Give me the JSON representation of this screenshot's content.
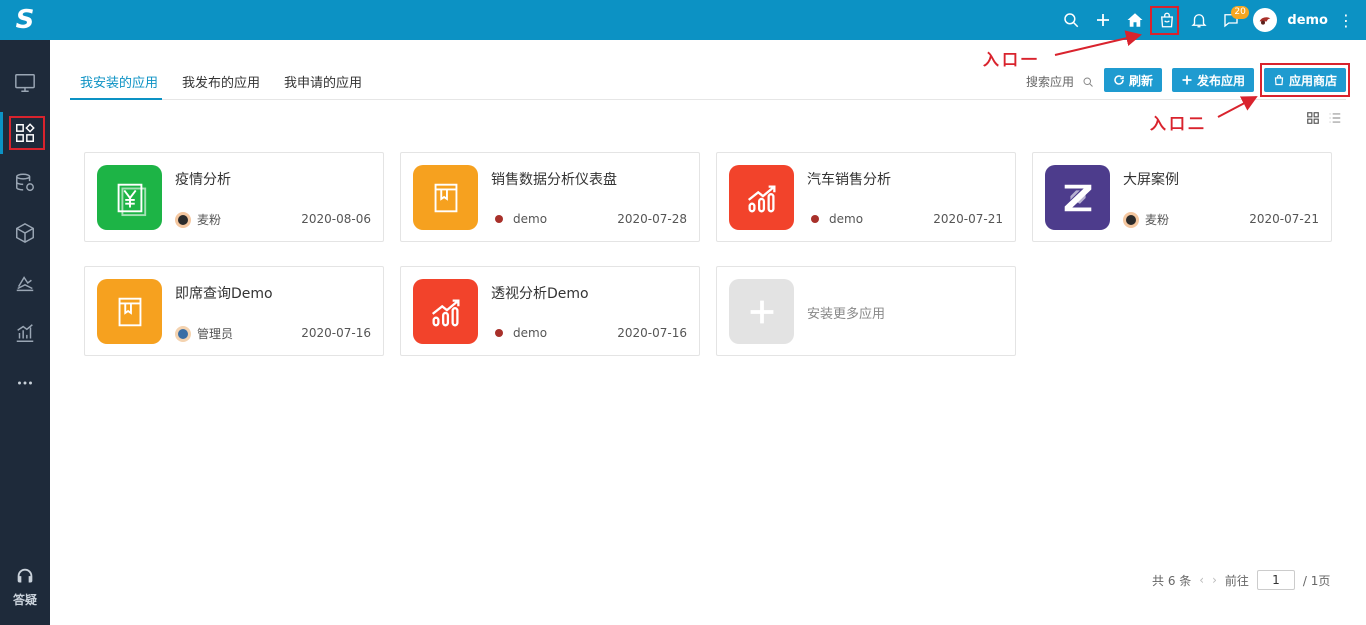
{
  "logo": "S",
  "sidebar": {
    "items": [
      {
        "icon": "monitor-icon"
      },
      {
        "icon": "apps-icon",
        "active": true
      },
      {
        "icon": "database-gear-icon"
      },
      {
        "icon": "cube-icon"
      },
      {
        "icon": "layers-chart-icon"
      },
      {
        "icon": "bar-chart-icon"
      },
      {
        "icon": "more-icon"
      }
    ],
    "help_label": "答疑"
  },
  "header": {
    "badge_count": "20",
    "user_name": "demo"
  },
  "tabs": [
    {
      "label": "我安装的应用",
      "active": true
    },
    {
      "label": "我发布的应用"
    },
    {
      "label": "我申请的应用"
    }
  ],
  "toolbar": {
    "search_label": "搜索应用",
    "refresh_label": "刷新",
    "publish_label": "发布应用",
    "store_label": "应用商店"
  },
  "annotations": {
    "entry_one": "入口一",
    "entry_two": "入口二"
  },
  "apps": [
    {
      "title": "疫情分析",
      "owner": "麦粉",
      "date": "2020-08-06",
      "color": "#1db446",
      "icon": "yuan-doc-icon"
    },
    {
      "title": "销售数据分析仪表盘",
      "owner": "demo",
      "date": "2020-07-28",
      "color": "#f6a11f",
      "icon": "book-icon"
    },
    {
      "title": "汽车销售分析",
      "owner": "demo",
      "date": "2020-07-21",
      "color": "#f2432b",
      "icon": "growth-chart-icon"
    },
    {
      "title": "大屏案例",
      "owner": "麦粉",
      "date": "2020-07-21",
      "color": "#4d3c8c",
      "icon": "z-logo-icon"
    },
    {
      "title": "即席查询Demo",
      "owner": "管理员",
      "date": "2020-07-16",
      "color": "#f6a11f",
      "icon": "book-icon"
    },
    {
      "title": "透视分析Demo",
      "owner": "demo",
      "date": "2020-07-16",
      "color": "#f2432b",
      "icon": "growth-chart-icon"
    }
  ],
  "more_apps_label": "安装更多应用",
  "pager": {
    "total": "共 6 条",
    "goto_label": "前往",
    "page_value": "1",
    "pages": "/ 1页"
  }
}
